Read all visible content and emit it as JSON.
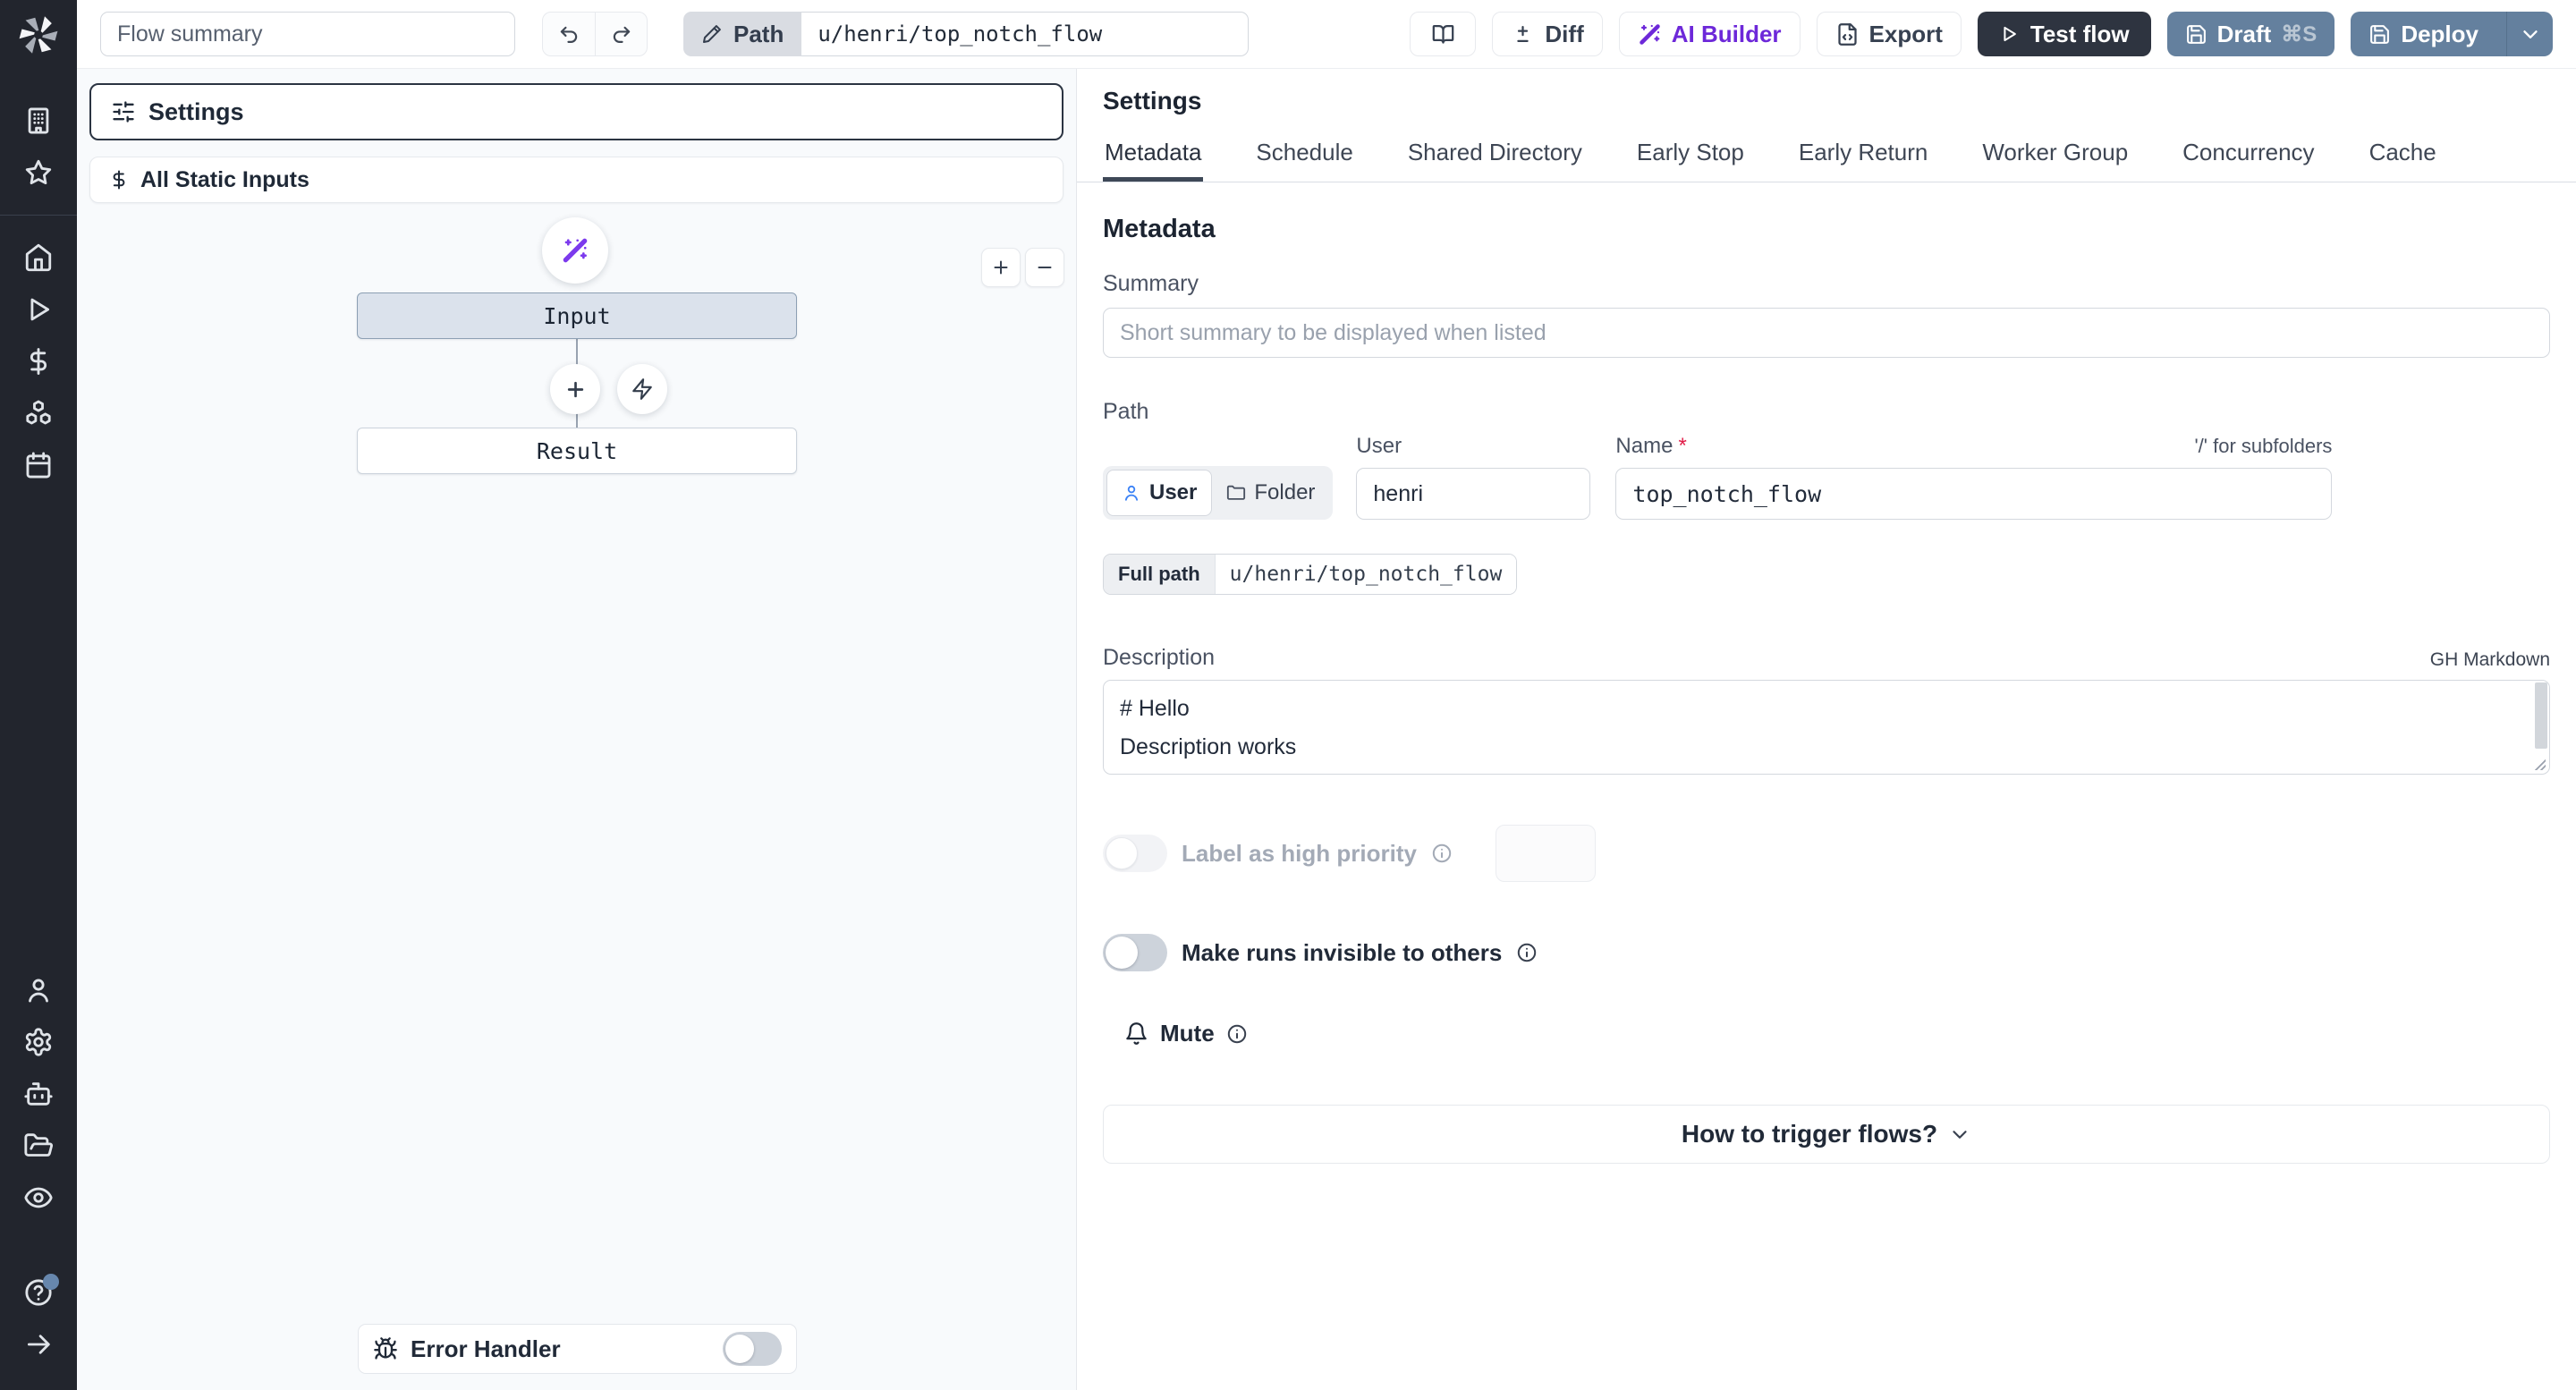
{
  "toolbar": {
    "flow_summary_placeholder": "Flow summary",
    "path_label": "Path",
    "path_value": "u/henri/top_notch_flow",
    "diff_label": "Diff",
    "ai_builder_label": "AI Builder",
    "export_label": "Export",
    "test_flow_label": "Test flow",
    "draft_label": "Draft",
    "draft_shortcut": "⌘S",
    "deploy_label": "Deploy"
  },
  "flow_panel": {
    "settings_card_label": "Settings",
    "static_inputs_label": "All Static Inputs",
    "input_node_label": "Input",
    "result_node_label": "Result",
    "error_handler_label": "Error Handler"
  },
  "settings_panel": {
    "title": "Settings",
    "tabs": [
      "Metadata",
      "Schedule",
      "Shared Directory",
      "Early Stop",
      "Early Return",
      "Worker Group",
      "Concurrency",
      "Cache"
    ],
    "metadata_heading": "Metadata",
    "summary_label": "Summary",
    "summary_placeholder": "Short summary to be displayed when listed",
    "path_section_label": "Path",
    "owner_user_label": "User",
    "owner_folder_label": "Folder",
    "user_field_label": "User",
    "user_field_value": "henri",
    "name_field_label": "Name",
    "name_required_mark": "*",
    "name_field_value": "top_notch_flow",
    "subfolders_hint": "'/' for subfolders",
    "full_path_label": "Full path",
    "full_path_value": "u/henri/top_notch_flow",
    "description_label": "Description",
    "markdown_hint": "GH Markdown",
    "description_value": "# Hello\nDescription works",
    "high_priority_label": "Label as high priority",
    "invisible_runs_label": "Make runs invisible to others",
    "mute_label": "Mute",
    "trigger_question_label": "How to trigger flows?"
  },
  "colors": {
    "accent_slate": "#64809e",
    "dark_button": "#2e3440",
    "ai_purple": "#6d28d9",
    "user_icon_blue": "#3b82f6",
    "sidebar_bg": "#22252d",
    "canvas_bg": "#f8fafc",
    "selected_node_bg": "#dbe2ec"
  }
}
